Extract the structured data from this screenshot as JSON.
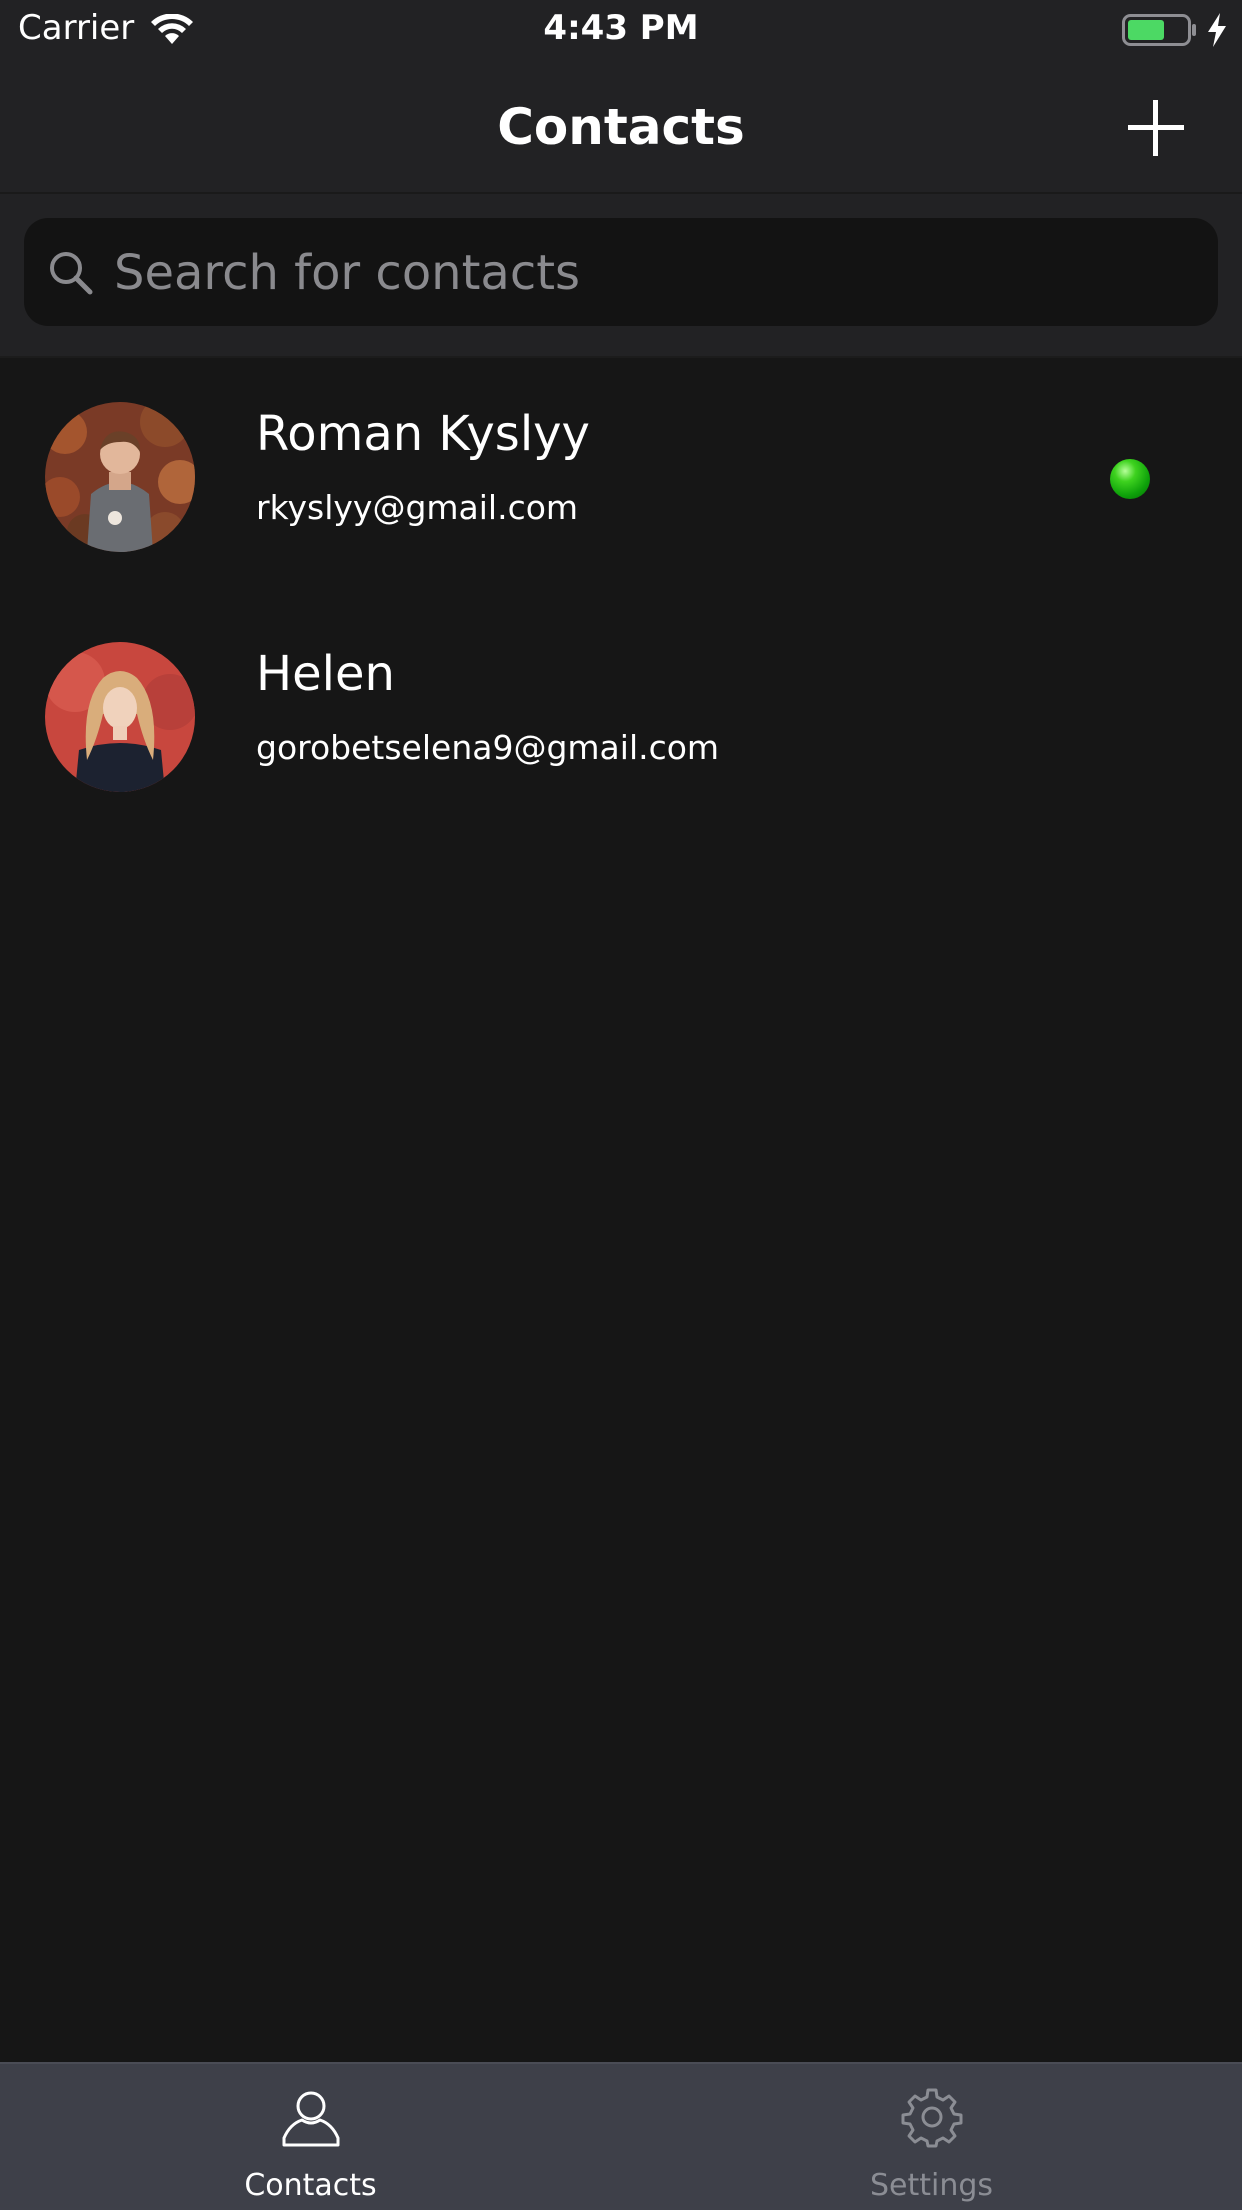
{
  "status_bar": {
    "carrier": "Carrier",
    "time": "4:43 PM",
    "battery_color": "#4cd964"
  },
  "nav": {
    "title": "Contacts",
    "add_icon": "plus-icon"
  },
  "search": {
    "placeholder": "Search for contacts",
    "value": "",
    "icon": "search-icon"
  },
  "contacts": [
    {
      "name": "Roman Kyslyy",
      "email": "rkyslyy@gmail.com",
      "online": true
    },
    {
      "name": "Helen",
      "email": "gorobetselena9@gmail.com",
      "online": false
    }
  ],
  "tabs": [
    {
      "label": "Contacts",
      "icon": "person-icon",
      "selected": true
    },
    {
      "label": "Settings",
      "icon": "gear-icon",
      "selected": false
    }
  ],
  "colors": {
    "background": "#161616",
    "bar": "#222224",
    "tab_bar": "#3e4049",
    "online": "#1fb51a"
  }
}
